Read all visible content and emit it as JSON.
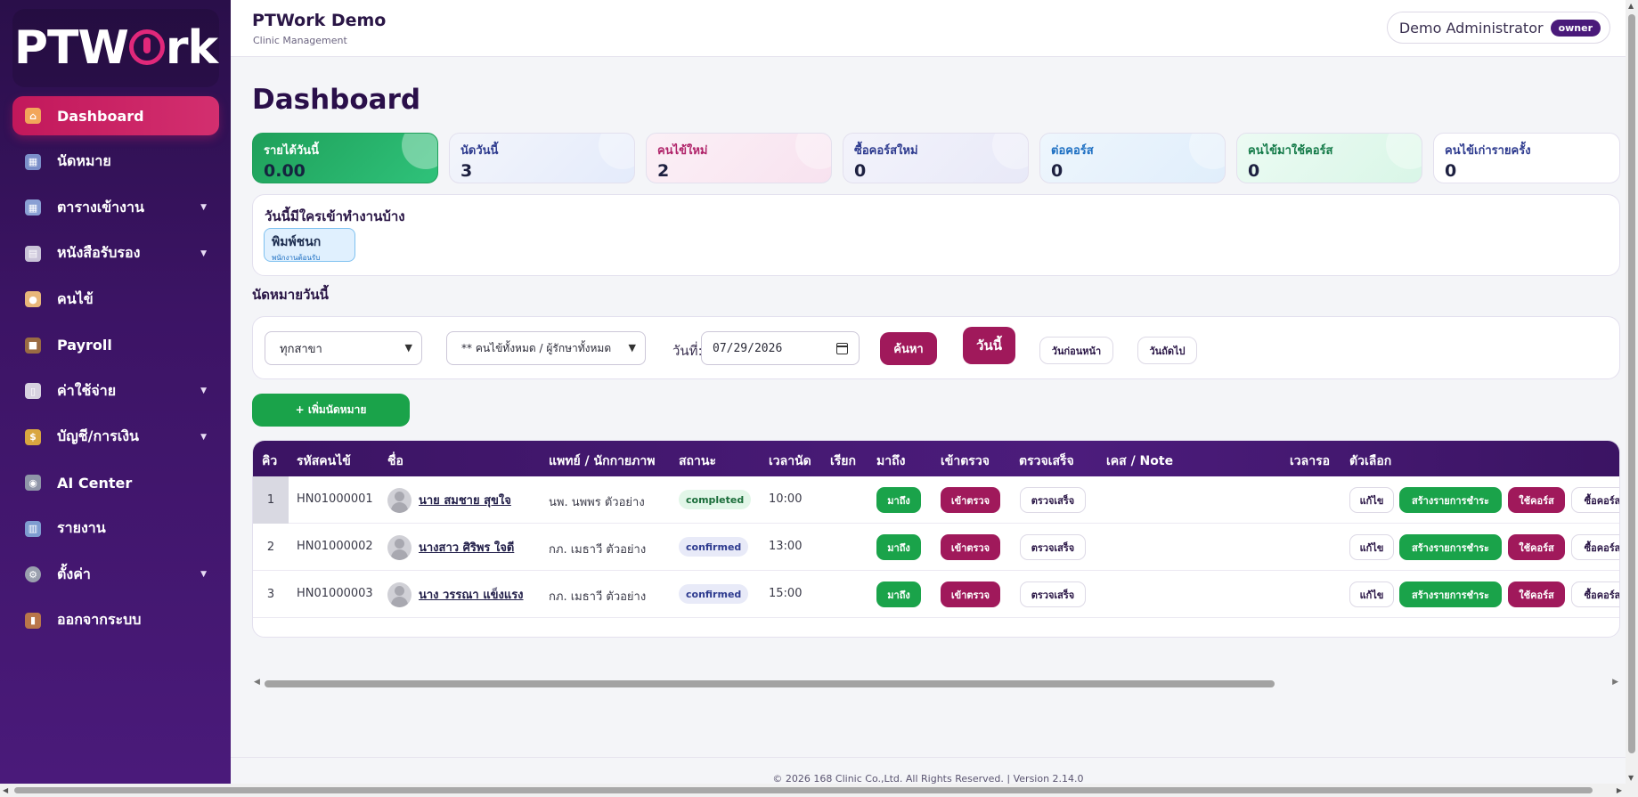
{
  "brand": {
    "logo_text_left": "PTW",
    "logo_text_right": "rk"
  },
  "header": {
    "title": "PTWork Demo",
    "subtitle": "Clinic Management",
    "user_name": "Demo Administrator",
    "role_badge": "owner"
  },
  "sidebar": {
    "items": [
      {
        "label": "Dashboard",
        "icon": "home-icon",
        "active": true,
        "has_caret": false
      },
      {
        "label": "นัดหมาย",
        "icon": "calendar-icon",
        "has_caret": false
      },
      {
        "label": "ตารางเข้างาน",
        "icon": "schedule-icon",
        "has_caret": true
      },
      {
        "label": "หนังสือรับรอง",
        "icon": "document-icon",
        "has_caret": true
      },
      {
        "label": "คนไข้",
        "icon": "patient-icon",
        "has_caret": false
      },
      {
        "label": "Payroll",
        "icon": "briefcase-icon",
        "has_caret": false
      },
      {
        "label": "ค่าใช้จ่าย",
        "icon": "receipt-icon",
        "has_caret": true
      },
      {
        "label": "บัญชี/การเงิน",
        "icon": "money-bag-icon",
        "has_caret": true
      },
      {
        "label": "AI Center",
        "icon": "robot-icon",
        "has_caret": false
      },
      {
        "label": "รายงาน",
        "icon": "chart-icon",
        "has_caret": false
      },
      {
        "label": "ตั้งค่า",
        "icon": "gear-icon",
        "has_caret": true
      },
      {
        "label": "ออกจากระบบ",
        "icon": "door-icon",
        "has_caret": false
      }
    ]
  },
  "page": {
    "title": "Dashboard"
  },
  "stats": [
    {
      "label": "รายได้วันนี้",
      "value": "0.00"
    },
    {
      "label": "นัดวันนี้",
      "value": "3"
    },
    {
      "label": "คนไข้ใหม่",
      "value": "2"
    },
    {
      "label": "ซื้อคอร์สใหม่",
      "value": "0"
    },
    {
      "label": "ต่อคอร์ส",
      "value": "0"
    },
    {
      "label": "คนไข้มาใช้คอร์ส",
      "value": "0"
    },
    {
      "label": "คนไข้เก่ารายครั้ง",
      "value": "0"
    }
  ],
  "on_duty": {
    "title": "วันนี้มีใครเข้าทำงานบ้าง",
    "staff_name": "พิมพ์ชนก",
    "staff_role": "พนักงานต้อนรับ"
  },
  "appointments": {
    "title": "นัดหมายวันนี้",
    "branch_select": "ทุกสาขา",
    "provider_select": "** คนไข้ทั้งหมด / ผู้รักษาทั้งหมด",
    "date_label": "วันที่:",
    "date_value": "07/29/2026",
    "search_button": "ค้นหา",
    "today_button": "วันนี้",
    "prev_button": "วันก่อนหน้า",
    "next_button": "วันถัดไป",
    "add_button": "+ เพิ่มนัดหมาย",
    "columns": [
      "คิว",
      "รหัสคนไข้",
      "ชื่อ",
      "แพทย์ / นักกายภาพ",
      "สถานะ",
      "เวลานัด",
      "เรียก",
      "มาถึง",
      "เข้าตรวจ",
      "ตรวจเสร็จ",
      "เคส / Note",
      "เวลารอ",
      "ตัวเลือก"
    ],
    "rows": [
      {
        "queue": "1",
        "hn": "HN01000001",
        "name": "นาย สมชาย สุขใจ",
        "provider": "นพ. นพพร ตัวอย่าง",
        "status": "completed",
        "time": "10:00"
      },
      {
        "queue": "2",
        "hn": "HN01000002",
        "name": "นางสาว ศิริพร ใจดี",
        "provider": "กภ. เมธาวี ตัวอย่าง",
        "status": "confirmed",
        "time": "13:00"
      },
      {
        "queue": "3",
        "hn": "HN01000003",
        "name": "นาง วรรณา แข็งแรง",
        "provider": "กภ. เมธาวี ตัวอย่าง",
        "status": "confirmed",
        "time": "15:00"
      }
    ],
    "row_buttons": {
      "arrived": "มาถึง",
      "checkin": "เข้าตรวจ",
      "done": "ตรวจเสร็จ",
      "edit": "แก้ไข",
      "payment": "สร้างรายการชำระ",
      "use_course": "ใช้คอร์ส",
      "buy_course": "ซื้อคอร์ส"
    }
  },
  "footer": {
    "text": "© 2026 168 Clinic Co.,Ltd. All Rights Reserved. | Version 2.14.0"
  },
  "colors": {
    "sidebar_top": "#2a0f4a",
    "accent_pink": "#c2185b",
    "maroon": "#a0195b",
    "green": "#1aa34a",
    "table_header": "#3b1463"
  }
}
